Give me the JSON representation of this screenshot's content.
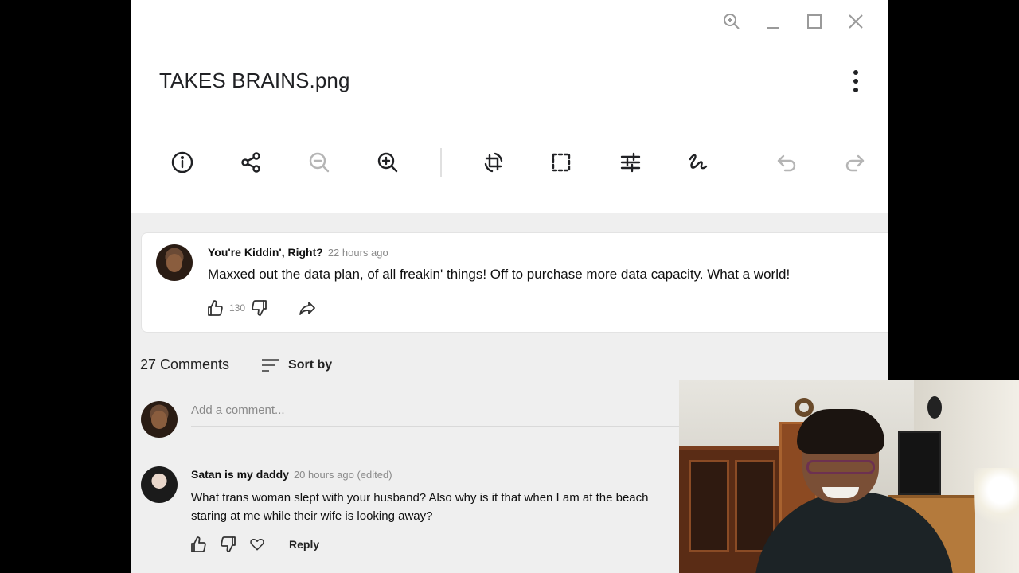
{
  "window": {
    "file_title": "TAKES BRAINS.png",
    "controls": [
      "zoom-icon",
      "minimize-icon",
      "maximize-icon",
      "close-icon"
    ]
  },
  "toolbar": {
    "tools": [
      "info-icon",
      "share-icon",
      "zoom-out-icon",
      "zoom-in-icon",
      "rotate-crop-icon",
      "crop-icon",
      "adjust-icon",
      "draw-icon",
      "undo-icon",
      "redo-icon"
    ],
    "disabled": [
      "zoom-out-icon",
      "undo-icon",
      "redo-icon"
    ]
  },
  "image": {
    "pinned_comment": {
      "author": "You're Kiddin', Right?",
      "time": "22 hours ago",
      "text": "Maxxed out the data plan, of all freakin' things! Off to purchase more data capacity. What a world!",
      "likes": "130"
    },
    "comments_header": {
      "count_label": "27 Comments",
      "sort_label": "Sort by"
    },
    "add_comment_placeholder": "Add a comment...",
    "comment": {
      "author": "Satan is my daddy",
      "time": "20 hours ago (edited)",
      "text_line1": "What trans woman slept with your husband? Also why is it that when I am at the beach",
      "text_line2": "staring at me while their wife is looking away?",
      "reply_label": "Reply"
    }
  },
  "colors": {
    "title_text": "#202124",
    "disabled_icon": "#b5b5b5",
    "viewer_bg": "#ffffff",
    "image_bg": "#efefef"
  }
}
